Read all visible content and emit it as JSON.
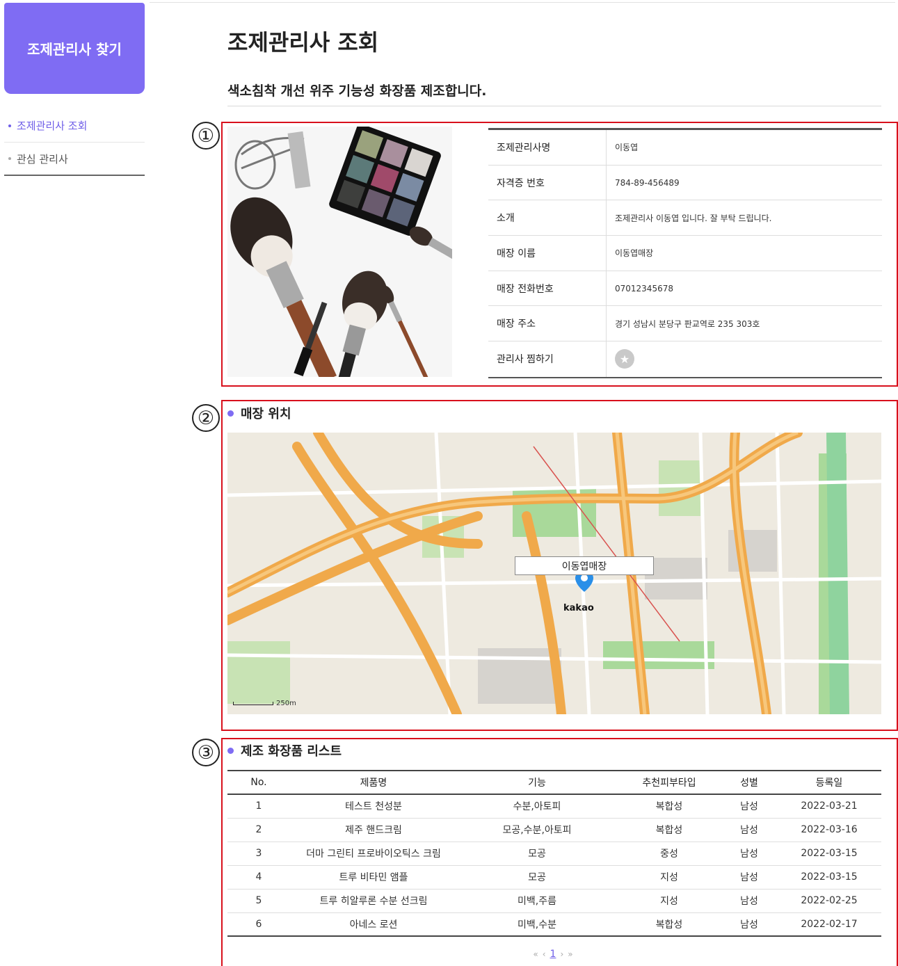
{
  "sidebar": {
    "header": "조제관리사 찾기",
    "items": [
      {
        "label": "조제관리사 조회"
      },
      {
        "label": "관심 관리사"
      }
    ]
  },
  "page": {
    "title": "조제관리사 조회",
    "subtitle": "색소침착 개선 위주 기능성 화장품 제조합니다."
  },
  "markers": [
    "①",
    "②",
    "③"
  ],
  "profile": {
    "rows": [
      {
        "label": "조제관리사명",
        "value": "이동엽"
      },
      {
        "label": "자격증 번호",
        "value": "784-89-456489"
      },
      {
        "label": "소개",
        "value": "조제관리사 이동엽 입니다. 잘 부탁 드립니다."
      },
      {
        "label": "매장 이름",
        "value": "이동엽매장"
      },
      {
        "label": "매장 전화번호",
        "value": "07012345678"
      },
      {
        "label": "매장 주소",
        "value": "경기 성남시 분당구 판교역로 235 303호"
      },
      {
        "label": "관리사 찜하기",
        "value": ""
      }
    ]
  },
  "location": {
    "heading": "매장 위치",
    "tooltip": "이동엽매장",
    "map_logo": "kakao",
    "map_scale": "250m"
  },
  "products": {
    "heading": "제조 화장품 리스트",
    "columns": [
      "No.",
      "제품명",
      "기능",
      "추천피부타입",
      "성별",
      "등록일"
    ],
    "rows": [
      [
        "1",
        "테스트 천성분",
        "수분,아토피",
        "복합성",
        "남성",
        "2022-03-21"
      ],
      [
        "2",
        "제주 핸드크림",
        "모공,수분,아토피",
        "복합성",
        "남성",
        "2022-03-16"
      ],
      [
        "3",
        "더마 그린티 프로바이오틱스 크림",
        "모공",
        "중성",
        "남성",
        "2022-03-15"
      ],
      [
        "4",
        "트루 비타민 앰플",
        "모공",
        "지성",
        "남성",
        "2022-03-15"
      ],
      [
        "5",
        "트루 히알루론 수분 선크림",
        "미백,주름",
        "지성",
        "남성",
        "2022-02-25"
      ],
      [
        "6",
        "아네스 로션",
        "미백,수분",
        "복합성",
        "남성",
        "2022-02-17"
      ]
    ]
  },
  "pagination": {
    "first": "«",
    "prev": "‹",
    "current": "1",
    "next": "›",
    "last": "»"
  },
  "colors": {
    "accent": "#7f6cf3",
    "highlight_box": "#d8101c"
  }
}
